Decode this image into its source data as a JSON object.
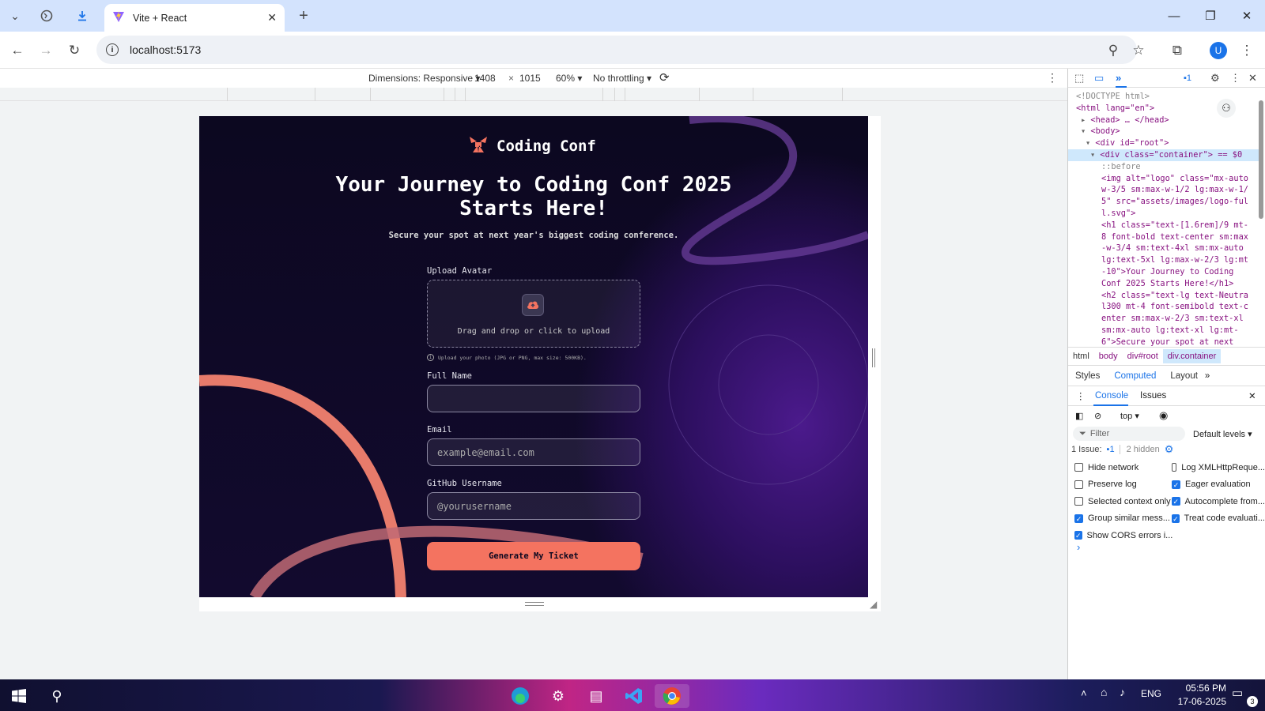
{
  "browser": {
    "tab_title": "Vite + React",
    "url": "localhost:5173",
    "profile_initial": "U"
  },
  "device_toolbar": {
    "dimensions_label": "Dimensions: Responsive",
    "width": "1408",
    "times": "×",
    "height": "1015",
    "zoom": "60%",
    "throttling": "No throttling"
  },
  "page": {
    "logo_text": "Coding Conf",
    "heading_line1": "Your Journey to Coding Conf 2025",
    "heading_line2": "Starts Here!",
    "subheading": "Secure your spot at next year's biggest coding conference.",
    "upload_label": "Upload Avatar",
    "upload_prompt": "Drag and drop or click to upload",
    "upload_hint": "Upload your photo (JPG or PNG, max size: 500KB).",
    "fullname_label": "Full Name",
    "fullname_value": "",
    "email_label": "Email",
    "email_placeholder": "example@email.com",
    "github_label": "GitHub Username",
    "github_placeholder": "@yourusername",
    "cta_label": "Generate My Ticket",
    "accent_color": "#f47360"
  },
  "devtools": {
    "elements_lines": [
      "<!DOCTYPE html>",
      "<html lang=\"en\">",
      "<head> … </head>",
      "<body>",
      "<div id=\"root\">",
      "<div class=\"container\"> == $0",
      "::before",
      "<img alt=\"logo\" class=\"mx-auto",
      "w-3/5 sm:max-w-1/2 lg:max-w-1/",
      "5\" src=\"assets/images/logo-ful",
      "l.svg\">",
      "<h1 class=\"text-[1.6rem]/9 mt-",
      "8 font-bold text-center sm:max",
      "-w-3/4 sm:text-4xl sm:mx-auto",
      "lg:text-5xl lg:max-w-2/3 lg:mt",
      "-10\">Your Journey to Coding",
      "Conf 2025 Starts Here!</h1>",
      "<h2 class=\"text-lg text-Neutra",
      "l300 mt-4 font-semibold text-c",
      "enter sm:max-w-2/3 sm:text-xl",
      "sm:mx-auto lg:text-xl lg:mt-",
      "6\">Secure your spot at next"
    ],
    "breadcrumbs": [
      "html",
      "body",
      "div#root",
      "div.container"
    ],
    "panel_tabs": [
      "Styles",
      "Computed",
      "Layout"
    ],
    "drawer_tabs": [
      "Console",
      "Issues"
    ],
    "context": "top",
    "filter_placeholder": "Filter",
    "levels": "Default levels",
    "issues_text": "1 Issue:",
    "issues_count": "1",
    "hidden_text": "2 hidden",
    "issue_badge": "1",
    "settings_left": [
      {
        "label": "Hide network",
        "checked": false
      },
      {
        "label": "Preserve log",
        "checked": false
      },
      {
        "label": "Selected context only",
        "checked": false
      },
      {
        "label": "Group similar mess...",
        "checked": true
      },
      {
        "label": "Show CORS errors i...",
        "checked": true
      }
    ],
    "settings_right": [
      {
        "label": "Log XMLHttpReque...",
        "checked": false
      },
      {
        "label": "Eager evaluation",
        "checked": true
      },
      {
        "label": "Autocomplete from...",
        "checked": true
      },
      {
        "label": "Treat code evaluati...",
        "checked": true
      }
    ],
    "prompt": "›"
  },
  "taskbar": {
    "time": "05:56 PM",
    "date": "17-06-2025",
    "lang": "ENG",
    "notif_count": "3"
  }
}
